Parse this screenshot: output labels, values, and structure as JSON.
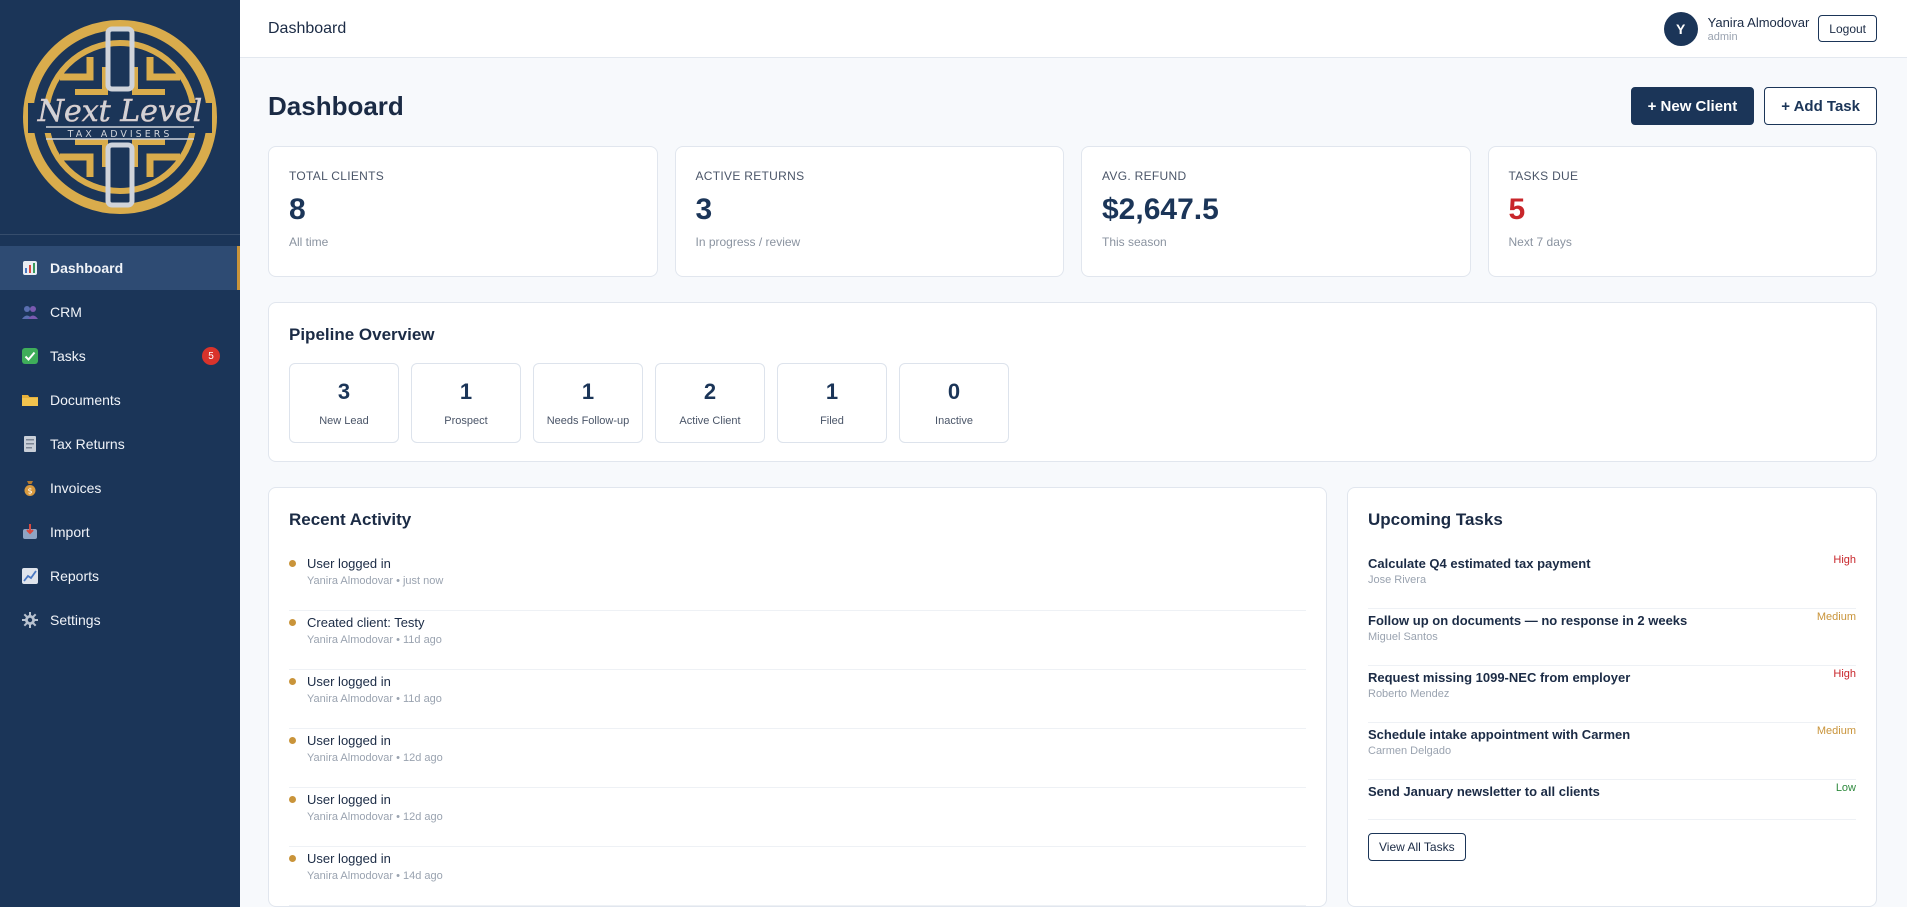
{
  "sidebar": {
    "brand": {
      "main": "Next Level",
      "sub": "TAX ADVISERS",
      "gold": "#d9ac4c",
      "silver": "#cfd3da"
    },
    "items": [
      {
        "label": "Dashboard",
        "icon": "chart-icon",
        "active": true
      },
      {
        "label": "CRM",
        "icon": "people-icon"
      },
      {
        "label": "Tasks",
        "icon": "checkbox-icon",
        "badge": "5"
      },
      {
        "label": "Documents",
        "icon": "folder-icon"
      },
      {
        "label": "Tax Returns",
        "icon": "document-icon"
      },
      {
        "label": "Invoices",
        "icon": "money-bag-icon"
      },
      {
        "label": "Import",
        "icon": "import-icon"
      },
      {
        "label": "Reports",
        "icon": "line-chart-icon"
      },
      {
        "label": "Settings",
        "icon": "gear-icon"
      }
    ]
  },
  "topbar": {
    "title": "Dashboard",
    "user": {
      "initial": "Y",
      "name": "Yanira Almodovar",
      "role": "admin"
    },
    "logout_label": "Logout"
  },
  "page": {
    "title": "Dashboard",
    "new_client_label": "+ New Client",
    "add_task_label": "+ Add Task"
  },
  "stats": [
    {
      "label": "TOTAL CLIENTS",
      "value": "8",
      "sub": "All time"
    },
    {
      "label": "ACTIVE RETURNS",
      "value": "3",
      "sub": "In progress / review"
    },
    {
      "label": "AVG. REFUND",
      "value": "$2,647.5",
      "sub": "This season"
    },
    {
      "label": "TASKS DUE",
      "value": "5",
      "sub": "Next 7 days",
      "color": "#c8262b"
    }
  ],
  "pipeline": {
    "title": "Pipeline Overview",
    "stages": [
      {
        "count": "3",
        "label": "New Lead"
      },
      {
        "count": "1",
        "label": "Prospect"
      },
      {
        "count": "1",
        "label": "Needs Follow-up"
      },
      {
        "count": "2",
        "label": "Active Client"
      },
      {
        "count": "1",
        "label": "Filed"
      },
      {
        "count": "0",
        "label": "Inactive"
      }
    ]
  },
  "activity": {
    "title": "Recent Activity",
    "items": [
      {
        "title": "User logged in",
        "meta": "Yanira Almodovar • just now"
      },
      {
        "title": "Created client: Testy",
        "meta": "Yanira Almodovar • 11d ago"
      },
      {
        "title": "User logged in",
        "meta": "Yanira Almodovar • 11d ago"
      },
      {
        "title": "User logged in",
        "meta": "Yanira Almodovar • 12d ago"
      },
      {
        "title": "User logged in",
        "meta": "Yanira Almodovar • 12d ago"
      },
      {
        "title": "User logged in",
        "meta": "Yanira Almodovar • 14d ago"
      }
    ]
  },
  "tasks": {
    "title": "Upcoming Tasks",
    "items": [
      {
        "title": "Calculate Q4 estimated tax payment",
        "client": "Jose Rivera",
        "priority": "High"
      },
      {
        "title": "Follow up on documents — no response in 2 weeks",
        "client": "Miguel Santos",
        "priority": "Medium"
      },
      {
        "title": "Request missing 1099-NEC from employer",
        "client": "Roberto Mendez",
        "priority": "High"
      },
      {
        "title": "Schedule intake appointment with Carmen",
        "client": "Carmen Delgado",
        "priority": "Medium"
      },
      {
        "title": "Send January newsletter to all clients",
        "client": "",
        "priority": "Low"
      }
    ],
    "view_all_label": "View All Tasks"
  }
}
